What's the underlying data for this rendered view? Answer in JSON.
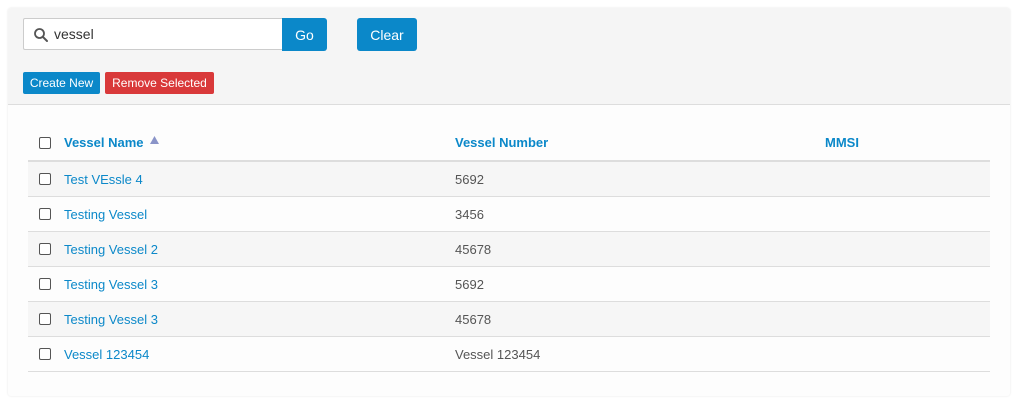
{
  "search": {
    "value": "vessel",
    "icon": "search-icon"
  },
  "toolbar": {
    "go_label": "Go",
    "clear_label": "Clear",
    "create_label": "Create New",
    "remove_label": "Remove Selected"
  },
  "table": {
    "columns": {
      "name": "Vessel Name",
      "number": "Vessel Number",
      "mmsi": "MMSI"
    },
    "sort": {
      "column": "name",
      "direction": "ascending",
      "icon": "sort-asc-icon"
    },
    "rows": [
      {
        "name": "Test VEssle 4",
        "number": "5692",
        "mmsi": ""
      },
      {
        "name": "Testing Vessel",
        "number": "3456",
        "mmsi": ""
      },
      {
        "name": "Testing Vessel 2",
        "number": "45678",
        "mmsi": ""
      },
      {
        "name": "Testing Vessel 3",
        "number": "5692",
        "mmsi": ""
      },
      {
        "name": "Testing Vessel 3",
        "number": "45678",
        "mmsi": ""
      },
      {
        "name": "Vessel 123454",
        "number": "Vessel 123454",
        "mmsi": ""
      }
    ]
  },
  "colors": {
    "primary": "#0b88c9",
    "danger": "#d9393a",
    "toolbar_bg": "#f5f5f5",
    "stripe_bg": "#f6f6f6"
  }
}
